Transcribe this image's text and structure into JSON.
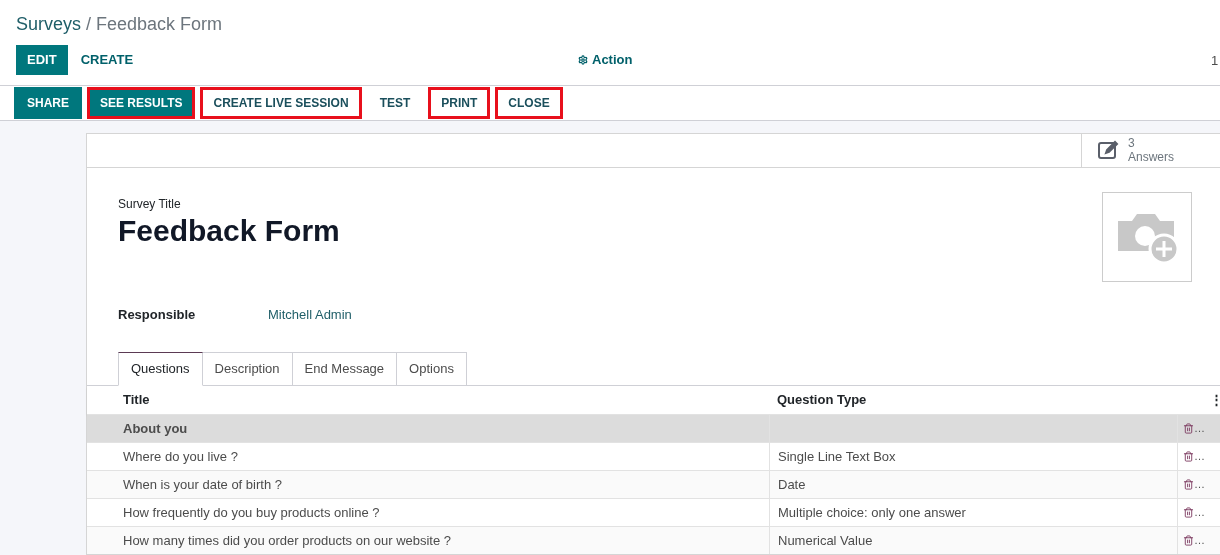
{
  "breadcrumb": {
    "parent": "Surveys",
    "separator": "/",
    "current": "Feedback Form"
  },
  "control_panel": {
    "buttons": [
      {
        "label": "EDIT",
        "primary": true
      },
      {
        "label": "CREATE",
        "primary": false
      }
    ],
    "action": {
      "label": "Action"
    },
    "pager": "1"
  },
  "status_bar": {
    "buttons": [
      {
        "label": "SHARE",
        "primary": true,
        "highlighted": false
      },
      {
        "label": "SEE RESULTS",
        "primary": true,
        "highlighted": true
      },
      {
        "label": "CREATE LIVE SESSION",
        "primary": false,
        "highlighted": true
      },
      {
        "label": "TEST",
        "primary": false,
        "highlighted": false
      },
      {
        "label": "PRINT",
        "primary": false,
        "highlighted": true
      },
      {
        "label": "CLOSE",
        "primary": false,
        "highlighted": true
      }
    ]
  },
  "stat_button": {
    "value": "3",
    "label": "Answers"
  },
  "form": {
    "title_label": "Survey Title",
    "title": "Feedback Form",
    "fields": [
      {
        "label": "Responsible",
        "value": "Mitchell Admin"
      }
    ]
  },
  "tabs": [
    {
      "label": "Questions",
      "selected": true
    },
    {
      "label": "Description",
      "selected": false
    },
    {
      "label": "End Message",
      "selected": false
    },
    {
      "label": "Options",
      "selected": false
    }
  ],
  "table": {
    "columns": [
      "Title",
      "Question Type"
    ],
    "column_menu": "⋮",
    "rows": [
      {
        "kind": "section",
        "title": "About you",
        "action": "…"
      },
      {
        "kind": "question",
        "title": "Where do you live ?",
        "type": "Single Line Text Box",
        "action": "…"
      },
      {
        "kind": "question",
        "title": "When is your date of birth ?",
        "type": "Date",
        "action": "…"
      },
      {
        "kind": "question",
        "title": "How frequently do you buy products online ?",
        "type": "Multiple choice: only one answer",
        "action": "…"
      },
      {
        "kind": "question",
        "title": "How many times did you order products on our website ?",
        "type": "Numerical Value",
        "action": "…"
      }
    ]
  }
}
